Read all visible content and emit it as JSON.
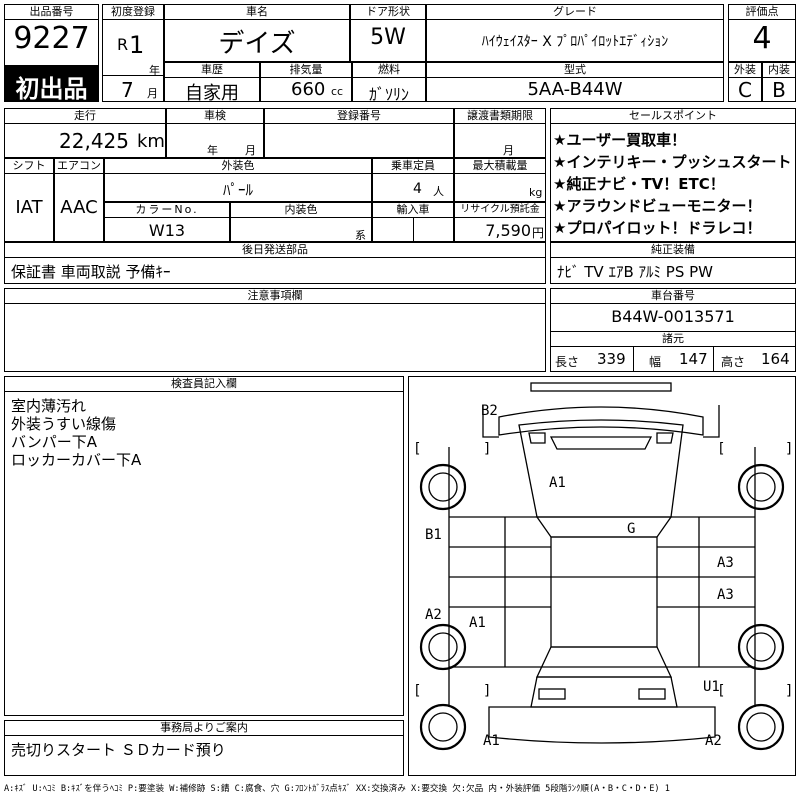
{
  "header": {
    "lot_no_label": "出品番号",
    "lot_no": "9227",
    "first_listing": "初出品",
    "first_reg_label": "初度登録",
    "era": "R",
    "reg_year": "1",
    "year_unit": "年",
    "reg_month": "7",
    "month_unit": "月",
    "car_name_label": "車名",
    "car_name": "デイズ",
    "door_label": "ドア形状",
    "door": "5W",
    "grade_label": "グレード",
    "grade": "ﾊｲｳｪｲｽﾀｰ X ﾌﾟﾛﾊﾟｲﾛｯﾄｴﾃﾞｨｼｮﾝ",
    "score_label": "評価点",
    "score": "4",
    "history_label": "車歴",
    "history": "自家用",
    "disp_label": "排気量",
    "displacement": "660",
    "cc": "cc",
    "fuel_label": "燃料",
    "fuel": "ｶﾞｿﾘﾝ",
    "model_label": "型式",
    "model": "5AA-B44W",
    "ext_label": "外装",
    "ext_grade": "C",
    "int_label": "内装",
    "int_grade": "B"
  },
  "row2": {
    "mileage_label": "走行",
    "mileage": "22,425",
    "km": "km",
    "inspection_label": "車検",
    "year_unit": "年",
    "month_unit": "月",
    "plate_label": "登録番号",
    "transfer_label": "譲渡書類期限",
    "shift_label": "シフト",
    "shift": "IAT",
    "ac_label": "エアコン",
    "ac": "AAC",
    "color_label": "外装色",
    "color": "ﾊﾟｰﾙ",
    "seats_label": "乗車定員",
    "seats": "4",
    "seats_unit": "人",
    "load_label": "最大積載量",
    "load_unit": "kg",
    "color_no_label": "カラーNo.",
    "color_no": "W13",
    "int_color_label": "内装色",
    "int_color_unit": "系",
    "import_label": "輸入車",
    "recycle_label": "リサイクル預託金",
    "recycle": "7,590",
    "yen": "円"
  },
  "sales": {
    "label": "セールスポイント",
    "items": [
      "★ユーザー買取車！",
      "★インテリキー・プッシュスタート",
      "★純正ナビ・TV！ETC！",
      "★アラウンドビューモニター！",
      "★プロパイロット！ドラレコ！"
    ]
  },
  "later_parts": {
    "label": "後日発送部品",
    "value": "保証書 車両取説 予備ｷｰ"
  },
  "oem": {
    "label": "純正装備",
    "value": "ﾅﾋﾞ TV ｴｱB ｱﾙﾐ PS PW"
  },
  "notes": {
    "label": "注意事項欄"
  },
  "chassis": {
    "label": "車台番号",
    "value": "B44W-0013571",
    "dims_label": "諸元",
    "len_label": "長さ",
    "len": "339",
    "wid_label": "幅",
    "wid": "147",
    "hgt_label": "高さ",
    "hgt": "164"
  },
  "inspector": {
    "label": "検査員記入欄",
    "lines": [
      "室内薄汚れ",
      "外装うすい線傷",
      "バンパー下A",
      "ロッカーカバー下A"
    ]
  },
  "office": {
    "label": "事務局よりご案内",
    "value": "売切りスタート ＳＤカード預り"
  },
  "legend": "A:ｷｽﾞ U:ﾍｺﾐ B:ｷｽﾞを伴うﾍｺﾐ P:要塗装 W:補修跡 S:錆 C:腐食、穴 G:ﾌﾛﾝﾄｶﾞﾗｽ点ｷｽﾞ XX:交換済み X:要交換 欠:欠品 内・外装評価 5段階ﾗﾝｸ順(A・B・C・D・E) 1",
  "diagram": {
    "marks": [
      "B2",
      "A1",
      "G",
      "B1",
      "A3",
      "A3",
      "A2",
      "A1",
      "U1",
      "A1",
      "A2"
    ],
    "brackets": [
      "[",
      "]",
      "[",
      "]",
      "[",
      "]",
      "[",
      "]"
    ]
  }
}
